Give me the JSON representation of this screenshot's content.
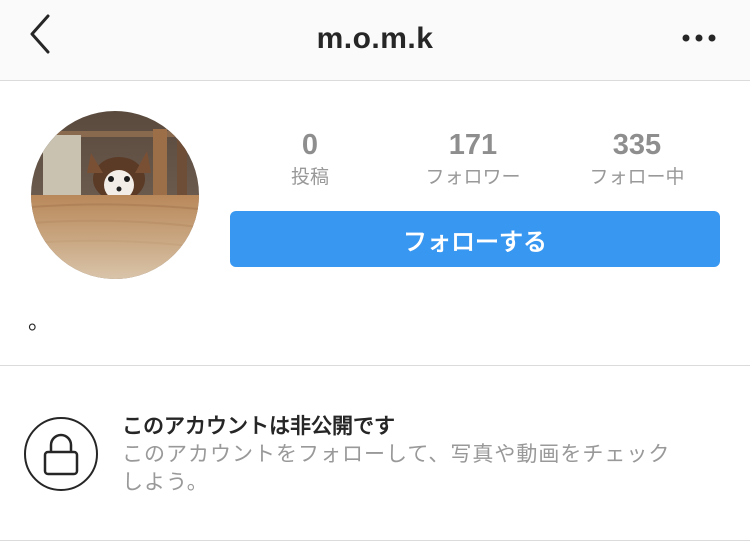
{
  "header": {
    "username": "m.o.m.k",
    "back_icon": "chevron-left-icon",
    "more_icon": "more-horizontal-icon"
  },
  "profile": {
    "avatar": "dog-under-table-photo",
    "stats": [
      {
        "count": "0",
        "label": "投稿"
      },
      {
        "count": "171",
        "label": "フォロワー"
      },
      {
        "count": "335",
        "label": "フォロー中"
      }
    ],
    "follow_button": "フォローする",
    "bio": "。"
  },
  "private_notice": {
    "icon": "lock-icon",
    "title": "このアカウントは非公開です",
    "description": "このアカウントをフォローして、写真や動画をチェックしよう。"
  },
  "colors": {
    "accent": "#3897f0",
    "text": "#262626",
    "muted": "#999999",
    "divider": "#dbdbdb",
    "header_bg": "#fafafa"
  }
}
